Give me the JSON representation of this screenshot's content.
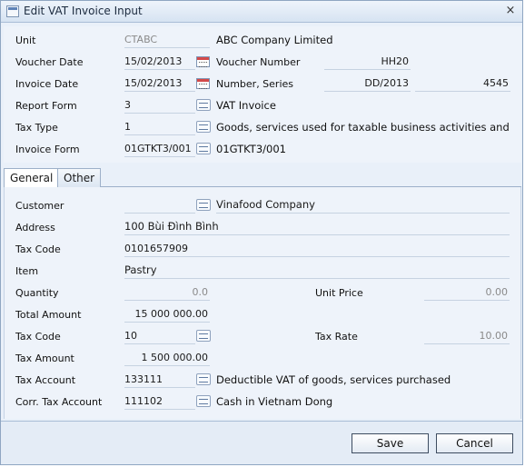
{
  "window": {
    "title": "Edit VAT Invoice Input",
    "close_glyph": "×"
  },
  "header_fields": {
    "unit_label": "Unit",
    "unit_code": "CTABC",
    "unit_name": "ABC Company Limited",
    "voucher_date_label": "Voucher Date",
    "voucher_date": "15/02/2013",
    "voucher_number_label": "Voucher Number",
    "voucher_number": "HH20",
    "invoice_date_label": "Invoice Date",
    "invoice_date": "15/02/2013",
    "number_series_label": "Number, Series",
    "series": "DD/2013",
    "number": "4545",
    "report_form_label": "Report Form",
    "report_form_code": "3",
    "report_form_name": "VAT Invoice",
    "tax_type_label": "Tax Type",
    "tax_type_code": "1",
    "tax_type_name": "Goods, services used for taxable business activities and",
    "invoice_form_label": "Invoice Form",
    "invoice_form_code": "01GTKT3/001",
    "invoice_form_name": "01GTKT3/001"
  },
  "tabs": [
    {
      "label": "General",
      "active": true
    },
    {
      "label": "Other",
      "active": false
    }
  ],
  "general": {
    "customer_label": "Customer",
    "customer_name": "Vinafood Company",
    "address_label": "Address",
    "address": "100 Bùi Đình Bình",
    "tax_code_label": "Tax Code",
    "tax_code": "0101657909",
    "item_label": "Item",
    "item": "Pastry",
    "quantity_label": "Quantity",
    "quantity": "0.0",
    "unit_price_label": "Unit Price",
    "unit_price": "0.00",
    "total_amount_label": "Total Amount",
    "total_amount": "15 000 000.00",
    "vat_code_label": "Tax Code",
    "vat_code": "10",
    "tax_rate_label": "Tax Rate",
    "tax_rate": "10.00",
    "tax_amount_label": "Tax Amount",
    "tax_amount": "1 500 000.00",
    "tax_account_label": "Tax Account",
    "tax_account_code": "133111",
    "tax_account_name": "Deductible VAT of goods, services purchased",
    "corr_account_label": "Corr. Tax Account",
    "corr_account_code": "111102",
    "corr_account_name": "Cash in Vietnam Dong"
  },
  "buttons": {
    "save": "Save",
    "cancel": "Cancel"
  }
}
